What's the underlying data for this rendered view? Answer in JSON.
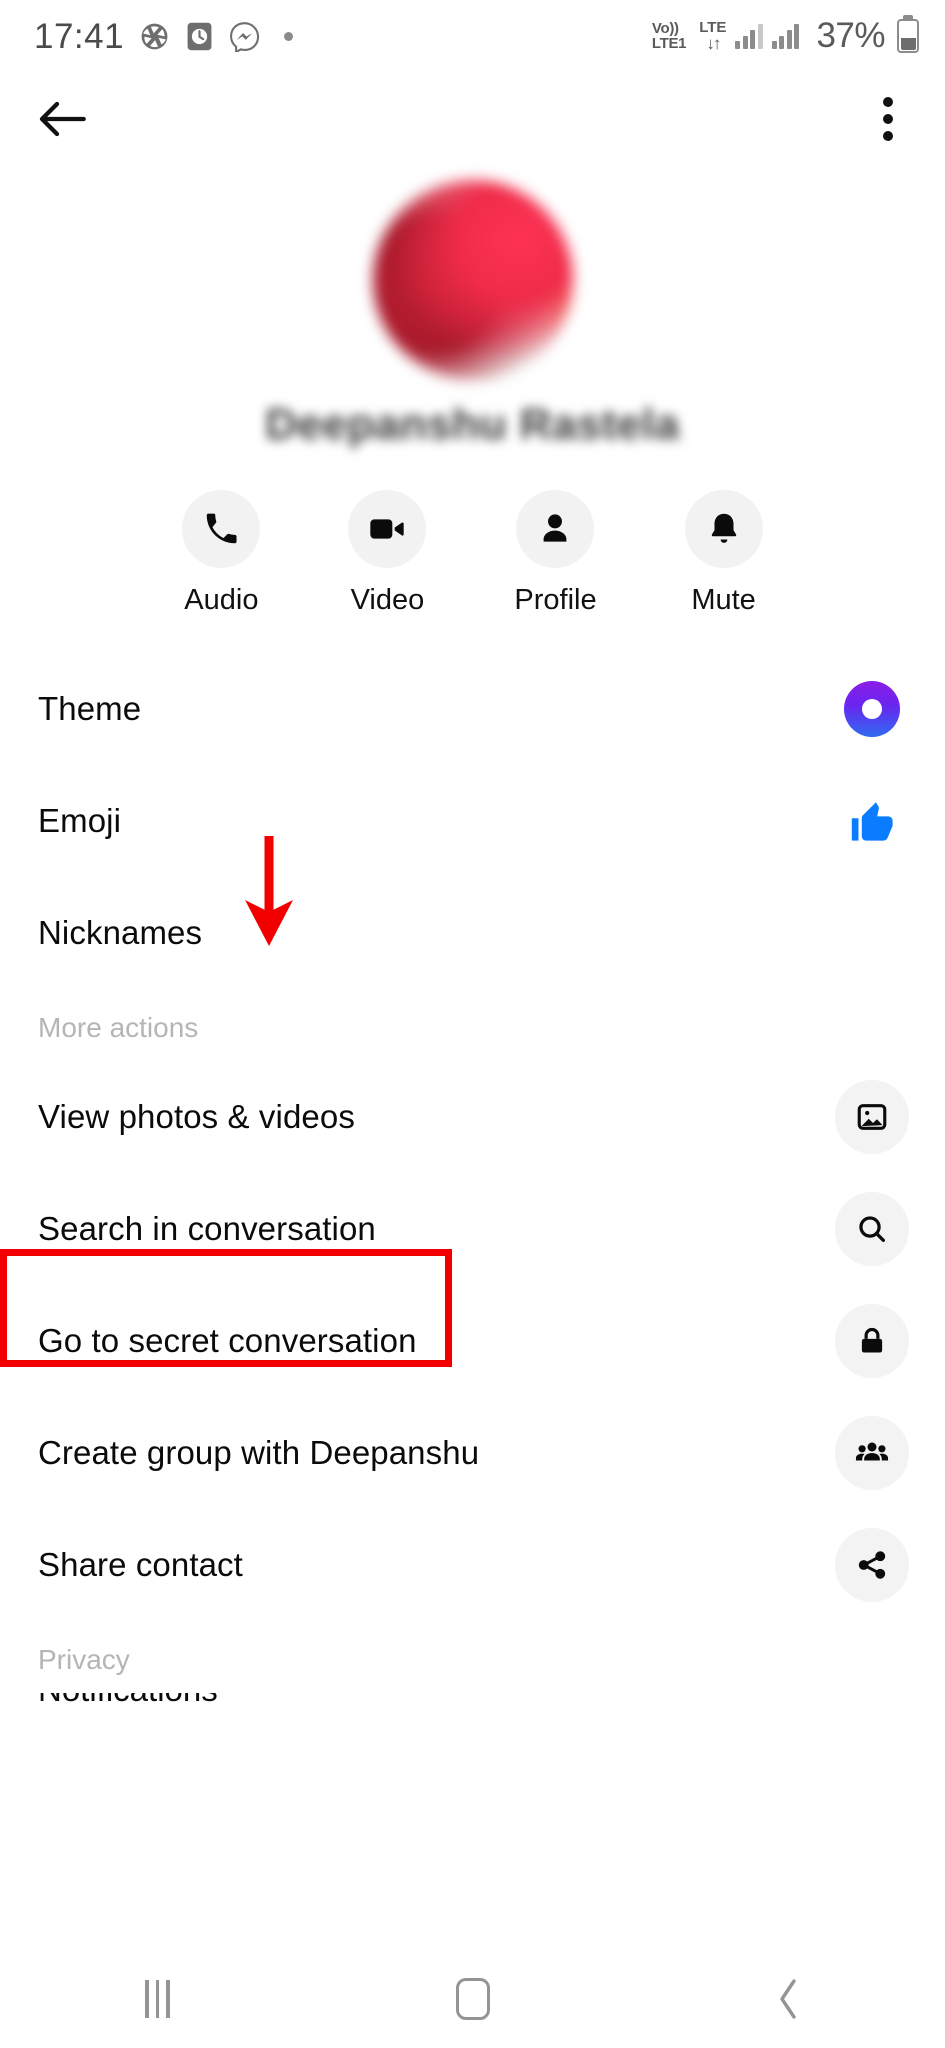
{
  "status_bar": {
    "time": "17:41",
    "left_icons": [
      "aperture-icon",
      "clock-box-icon",
      "messenger-icon",
      "dot-icon"
    ],
    "volte_line1": "Vo))",
    "volte_line2": "LTE1",
    "lte_label": "LTE",
    "data_arrows": "↓↑",
    "battery_percent": "37%",
    "battery_level": 37
  },
  "app_bar": {
    "back_label": "Back",
    "overflow_label": "More options"
  },
  "profile": {
    "name": "Deepanshu Rastela",
    "avatar_alt": "Profile photo"
  },
  "quick_actions": [
    {
      "label": "Audio",
      "icon": "phone-icon"
    },
    {
      "label": "Video",
      "icon": "video-camera-icon"
    },
    {
      "label": "Profile",
      "icon": "person-icon"
    },
    {
      "label": "Mute",
      "icon": "bell-icon"
    }
  ],
  "menu": {
    "primary": [
      {
        "label": "Theme",
        "icon": "theme-gradient-ring-icon"
      },
      {
        "label": "Emoji",
        "icon": "thumbs-up-icon"
      },
      {
        "label": "Nicknames",
        "icon": "none"
      }
    ],
    "more_actions_header": "More actions",
    "more_actions": [
      {
        "label": "View photos & videos",
        "icon": "photo-icon",
        "highlighted": true
      },
      {
        "label": "Search in conversation",
        "icon": "search-icon",
        "highlighted": false
      },
      {
        "label": "Go to secret conversation",
        "icon": "lock-icon",
        "highlighted": false
      },
      {
        "label": "Create group with Deepanshu",
        "icon": "people-group-icon",
        "highlighted": false
      },
      {
        "label": "Share contact",
        "icon": "share-icon",
        "highlighted": false
      }
    ],
    "privacy_header": "Privacy",
    "privacy_cut_item": "Notifications"
  },
  "annotation": {
    "arrow": "red-down-arrow",
    "highlight_box": "red-rectangle-around-view-photos-and-videos",
    "color": "#F20000"
  },
  "nav_bar": {
    "recents_label": "Recents",
    "home_label": "Home",
    "back_label": "Back"
  },
  "colors": {
    "accent_blue": "#0A7CFF",
    "theme_gradient_start": "#8B1EE8",
    "theme_gradient_end": "#2F6BF0",
    "annotation_red": "#F20000",
    "icon_bg": "#F3F3F3",
    "muted_text": "#B5B5B5"
  }
}
